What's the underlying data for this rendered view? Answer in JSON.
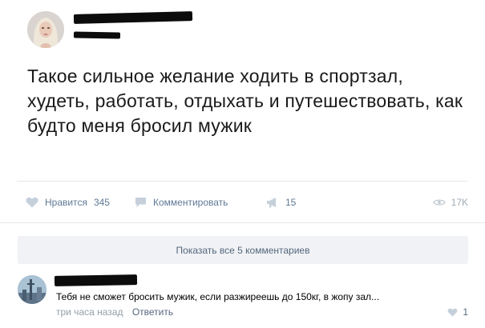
{
  "post": {
    "text": "Такое сильное желание ходить в спортзал, худеть, работать, отдыхать и путешествовать, как будто меня бросил мужик"
  },
  "actions": {
    "like_label": "Нравится",
    "like_count": "345",
    "comment_label": "Комментировать",
    "share_count": "15",
    "views_count": "17K"
  },
  "comments": {
    "show_all_label": "Показать все 5 комментариев",
    "items": [
      {
        "text": "Тебя не сможет бросить мужик, если разжиреешь до 150кг, в жопу зал...",
        "time": "три часа назад",
        "reply_label": "Ответить",
        "like_count": "1"
      }
    ]
  },
  "icons": {
    "like": "heart-icon",
    "comment": "speech-bubble-icon",
    "share": "megaphone-icon",
    "views": "eye-icon"
  },
  "colors": {
    "action_text": "#5f7896",
    "muted_text": "#939ea9",
    "divider": "#e4e7ea",
    "show_all_bg": "#f0f2f5"
  }
}
